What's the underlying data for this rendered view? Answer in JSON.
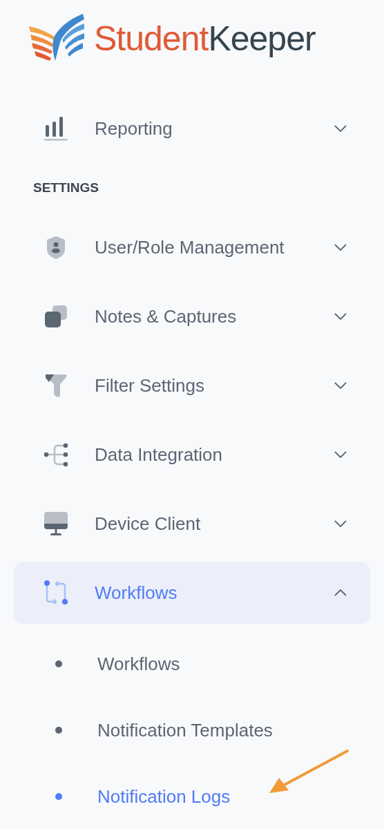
{
  "logo": {
    "part_1": "Student",
    "part_2": "Keeper"
  },
  "top_items": [
    {
      "label": "Reporting",
      "expanded": false,
      "selected": false
    }
  ],
  "section_title": "SETTINGS",
  "items": [
    {
      "label": "User/Role Management",
      "expanded": false,
      "selected": false
    },
    {
      "label": "Notes & Captures",
      "expanded": false,
      "selected": false
    },
    {
      "label": "Filter Settings",
      "expanded": false,
      "selected": false
    },
    {
      "label": "Data Integration",
      "expanded": false,
      "selected": false
    },
    {
      "label": "Device Client",
      "expanded": false,
      "selected": false
    },
    {
      "label": "Workflows",
      "expanded": true,
      "selected": true
    }
  ],
  "sub_items": [
    {
      "label": "Workflows",
      "selected": false
    },
    {
      "label": "Notification Templates",
      "selected": false
    },
    {
      "label": "Notification Logs",
      "selected": true
    }
  ]
}
